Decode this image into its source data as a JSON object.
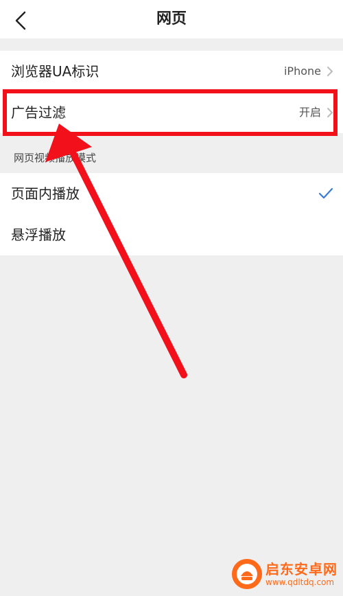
{
  "header": {
    "title": "网页",
    "back_icon": "chevron-left-icon"
  },
  "settings": [
    {
      "label": "浏览器UA标识",
      "value": "iPhone"
    },
    {
      "label": "广告过滤",
      "value": "开启"
    }
  ],
  "video_mode": {
    "section_title": "网页视频播放模式",
    "options": [
      {
        "label": "页面内播放",
        "selected": true
      },
      {
        "label": "悬浮播放",
        "selected": false
      }
    ]
  },
  "annotation": {
    "highlight_color": "#f2101a",
    "arrow_color": "#f2101a"
  },
  "watermark": {
    "name": "启东安卓网",
    "url": "www.qdltdq.com",
    "color": "#ff6a1a"
  },
  "colors": {
    "accent_check": "#3a7bd5",
    "background": "#efefef"
  }
}
